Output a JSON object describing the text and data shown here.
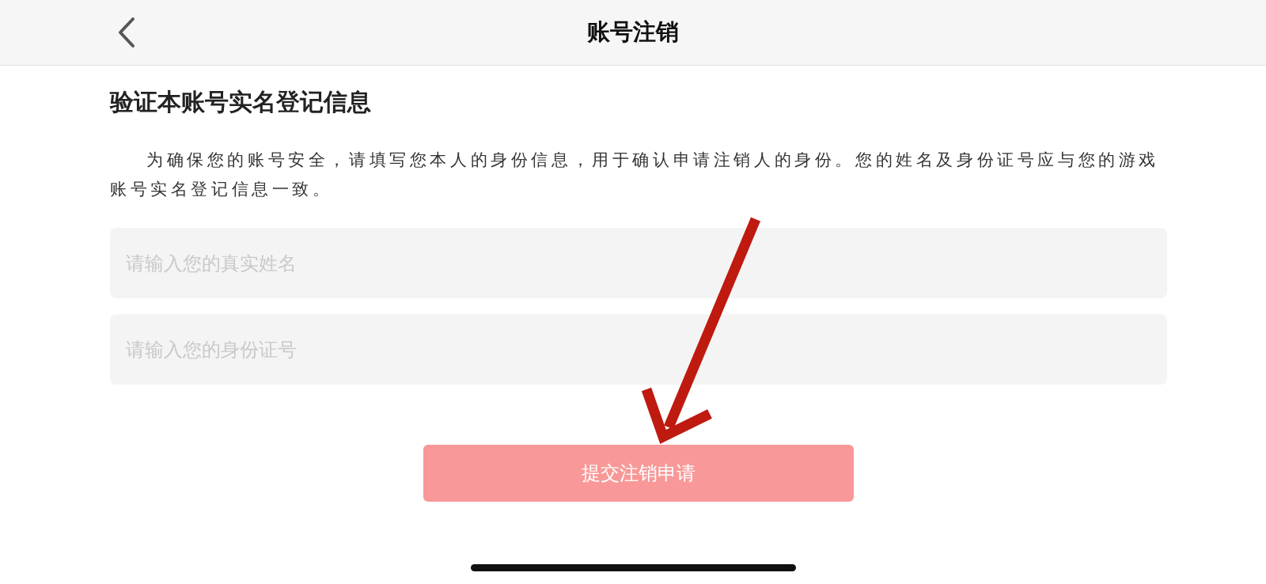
{
  "header": {
    "title": "账号注销"
  },
  "heading": "验证本账号实名登记信息",
  "description": "为确保您的账号安全，请填写您本人的身份信息，用于确认申请注销人的身份。您的姓名及身份证号应与您的游戏账号实名登记信息一致。",
  "fields": [
    {
      "placeholder": "请输入您的真实姓名"
    },
    {
      "placeholder": "请输入您的身份证号"
    }
  ],
  "submit_button": {
    "label": "提交注销申请",
    "disabled": true
  }
}
